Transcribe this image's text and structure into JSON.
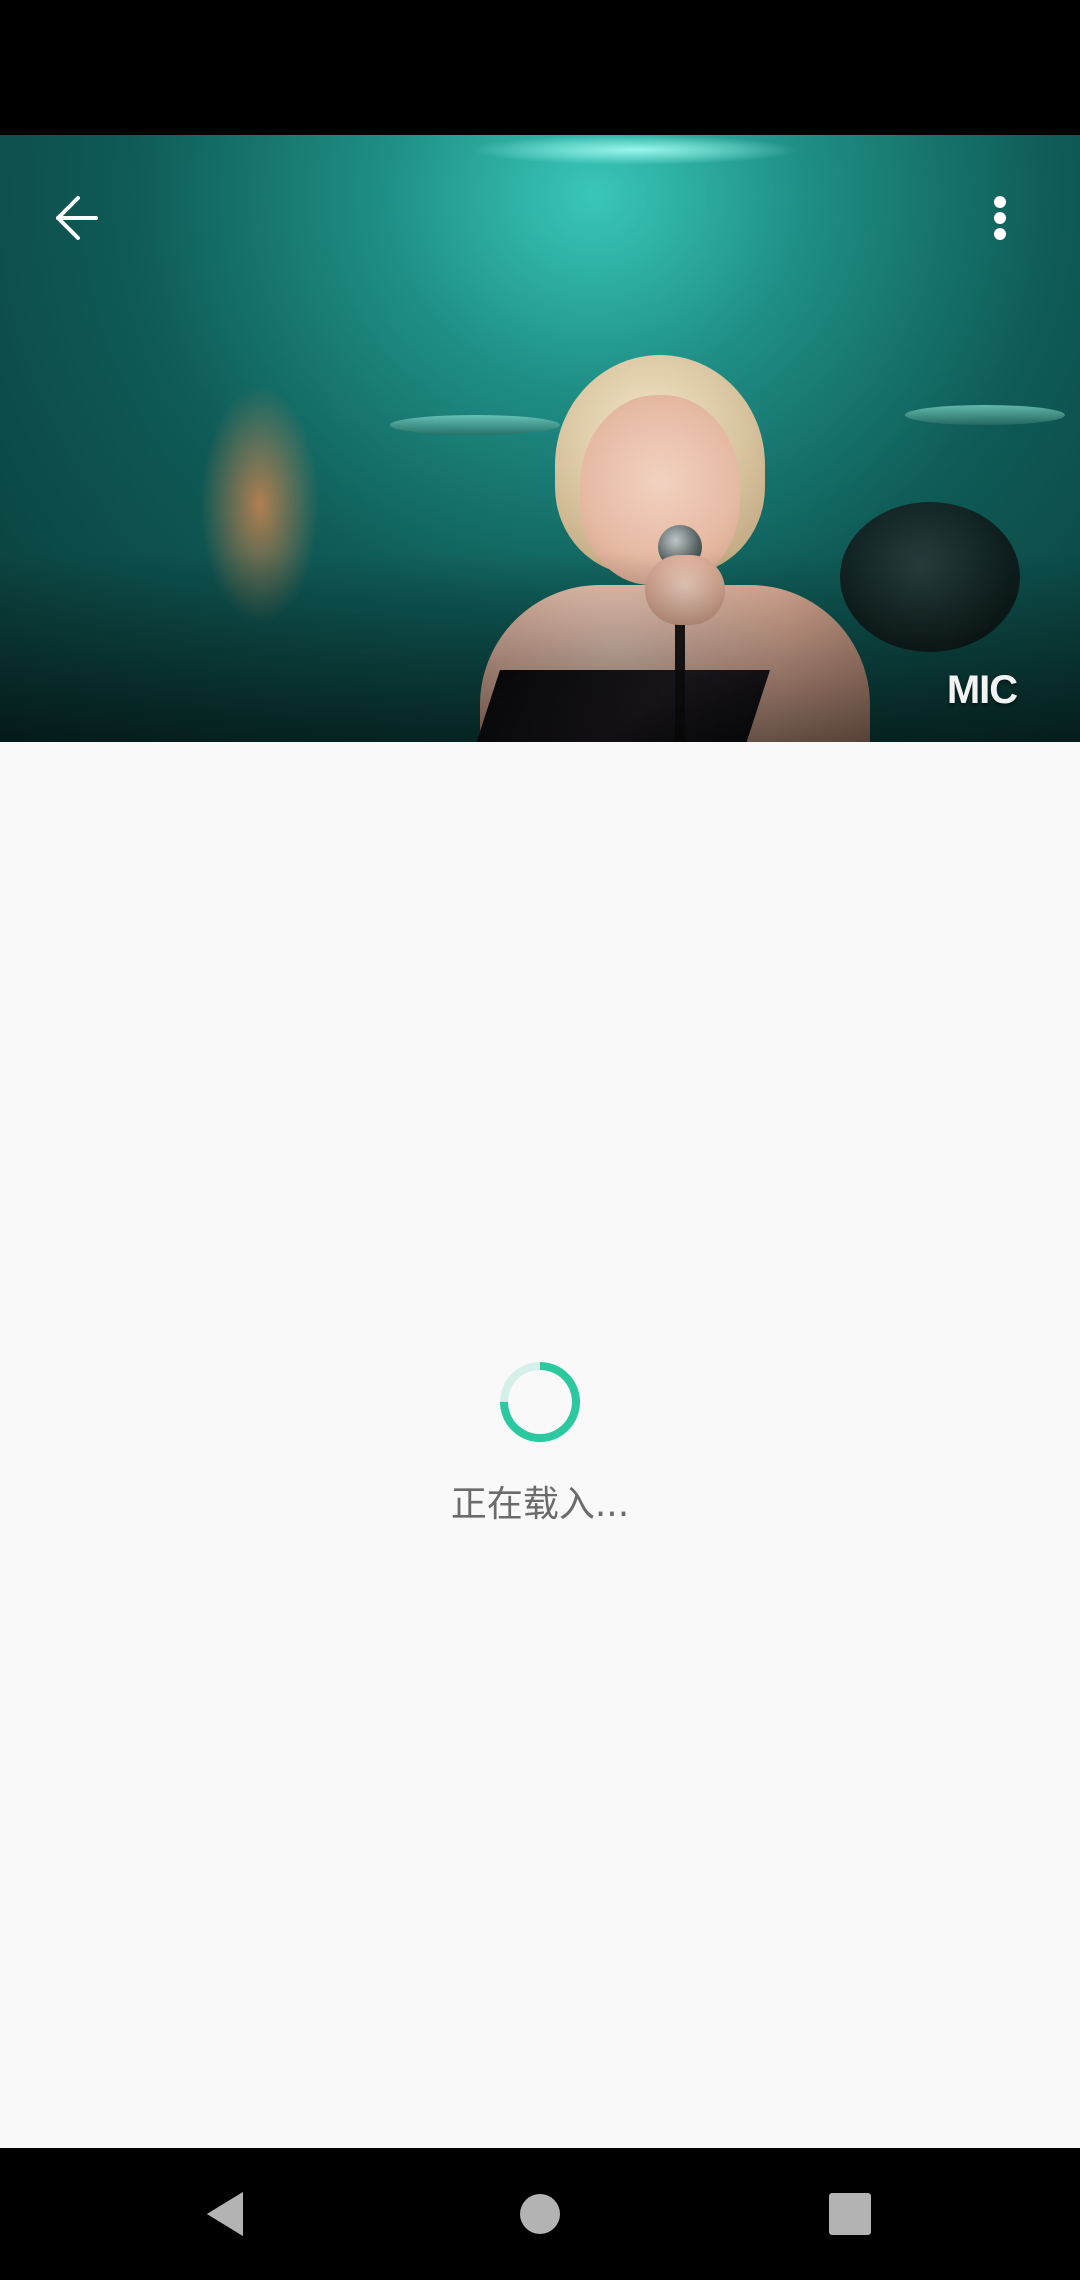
{
  "video_overlay": {
    "watermark_text": "MIC",
    "icons": {
      "back": "arrow-left-icon",
      "more": "more-vertical-icon"
    },
    "icon_color": "#ffffff"
  },
  "loading": {
    "text": "正在载入...",
    "spinner_color": "#2cc8a0"
  },
  "navigation_bar": {
    "buttons": [
      "back-triangle-icon",
      "home-circle-icon",
      "recent-square-icon"
    ],
    "icon_color": "#b3b3b3"
  }
}
